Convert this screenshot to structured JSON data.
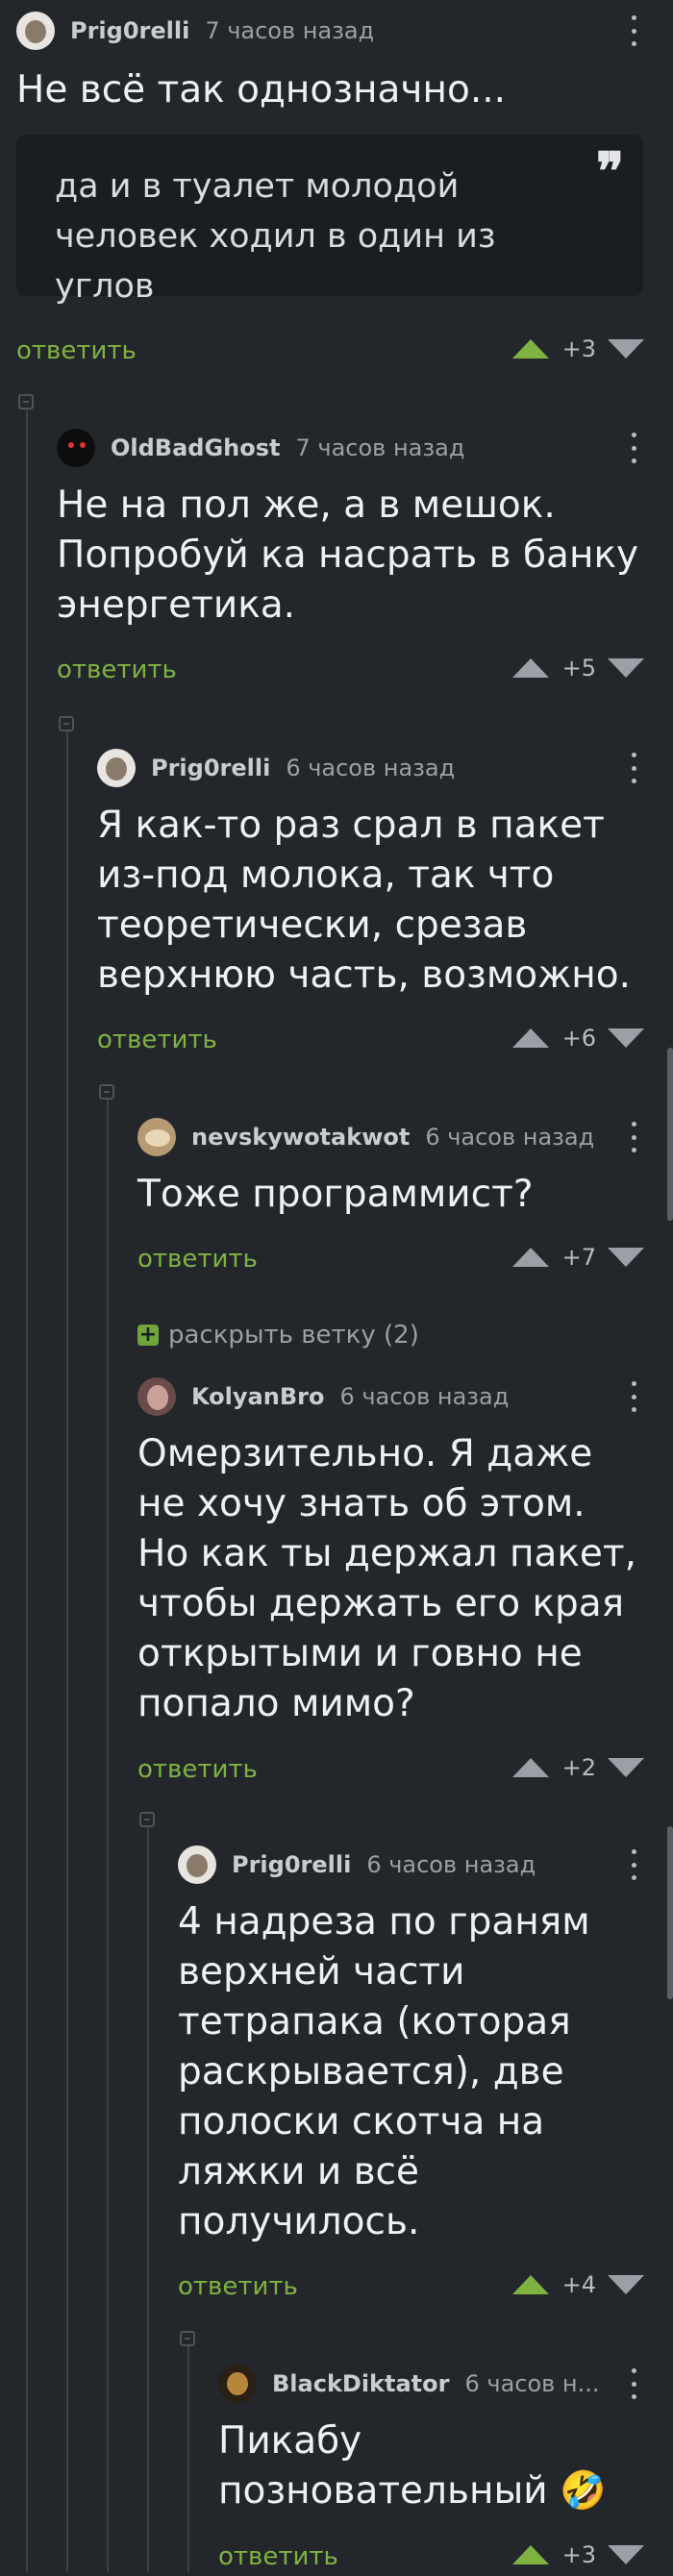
{
  "comments": [
    {
      "author": "Prig0relli",
      "time": "7 часов назад",
      "title": "Не всё так однозначно...",
      "quote": "да и в туалет молодой человек ходил в один из углов",
      "reply": "ответить",
      "score": "+3",
      "voted": "up"
    },
    {
      "author": "OldBadGhost",
      "time": "7 часов назад",
      "text": "Не на пол же, а в мешок. Попробуй ка насрать в банку энергетика.",
      "reply": "ответить",
      "score": "+5",
      "voted": "none"
    },
    {
      "author": "Prig0relli",
      "time": "6 часов назад",
      "text": "Я как-то раз срал в пакет из-под молока, так что теоретически, срезав верхнюю часть, возможно.",
      "reply": "ответить",
      "score": "+6",
      "voted": "none"
    },
    {
      "author": "nevskywotakwot",
      "time": "6 часов назад",
      "text": "Тоже программист?",
      "reply": "ответить",
      "score": "+7",
      "voted": "none"
    },
    {
      "author": "KolyanBro",
      "time": "6 часов назад",
      "text": "Омерзительно. Я даже не хочу знать об этом. Но как ты держал пакет, чтобы держать его края открытыми и говно не попало мимо?",
      "reply": "ответить",
      "score": "+2",
      "voted": "none"
    },
    {
      "author": "Prig0relli",
      "time": "6 часов назад",
      "text": "4 надреза по граням верхней части тетрапака (которая раскрывается), две полоски скотча на ляжки и всё получилось.",
      "reply": "ответить",
      "score": "+4",
      "voted": "up"
    },
    {
      "author": "BlackDiktator",
      "time": "6 часов н...",
      "text": "Пикабу позновательный 🤣",
      "reply": "ответить",
      "score": "+3",
      "voted": "up"
    }
  ],
  "expand_thread": {
    "label": "раскрыть ветку (2)",
    "icon": "plus-icon"
  },
  "colors": {
    "background": "#23272b",
    "accent_green": "#7fb241",
    "text": "#eef0f2",
    "muted": "#9aa0a6"
  }
}
